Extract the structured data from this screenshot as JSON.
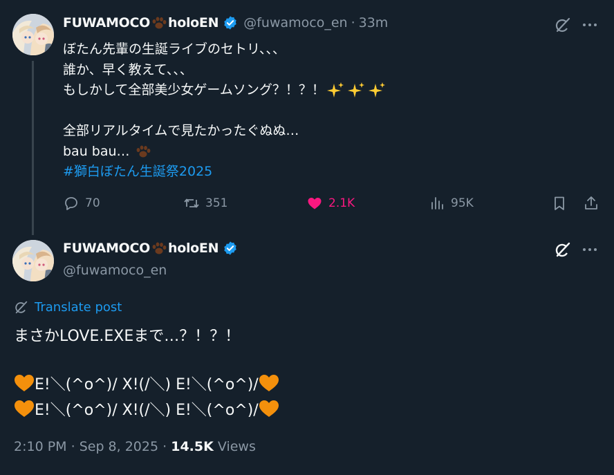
{
  "tweet": {
    "author_name": "FUWAMOCO",
    "author_suffix": "holoEN",
    "handle": "@fuwamoco_en",
    "separator": "·",
    "time_ago": "33m",
    "lines": [
      "ぼたん先輩の生誕ライブのセトリ、、、",
      "誰か、早く教えて、、、",
      "もしかして全部美少女ゲームソング？！？！",
      "",
      "全部リアルタイムで見たかったぐぬぬ…",
      "bau bau…"
    ],
    "hashtag": "#獅白ぼたん生誕祭2025",
    "actions": {
      "replies": "70",
      "reposts": "351",
      "likes": "2.1K",
      "views": "95K"
    }
  },
  "reply": {
    "author_name": "FUWAMOCO",
    "author_suffix": "holoEN",
    "handle": "@fuwamoco_en",
    "translate_label": "Translate post",
    "line1": "まさかLOVE.EXEまで…？！？！",
    "line2": "E!＼(^o^)/ X!(/＼) E!＼(^o^)/",
    "line3": "E!＼(^o^)/ X!(/＼) E!＼(^o^)/",
    "time": "2:10 PM",
    "separator": "·",
    "date": "Sep 8, 2025",
    "views_count": "14.5K",
    "views_label": "Views"
  },
  "icons": {
    "grok": "grok-icon",
    "more": "more-icon",
    "reply": "reply-icon",
    "repost": "repost-icon",
    "like": "heart-icon",
    "views": "views-icon",
    "bookmark": "bookmark-icon",
    "share": "share-icon",
    "translate": "translate-icon",
    "verified": "verified-badge-icon",
    "paw": "paw-emoji-icon",
    "sparkles": "sparkles-emoji-icon",
    "orange_heart": "orange-heart-emoji-icon"
  },
  "colors": {
    "background": "#15202b",
    "link": "#1d9bf0",
    "muted": "#8b98a5",
    "like": "#f91880",
    "orange_heart": "#f4900c"
  }
}
